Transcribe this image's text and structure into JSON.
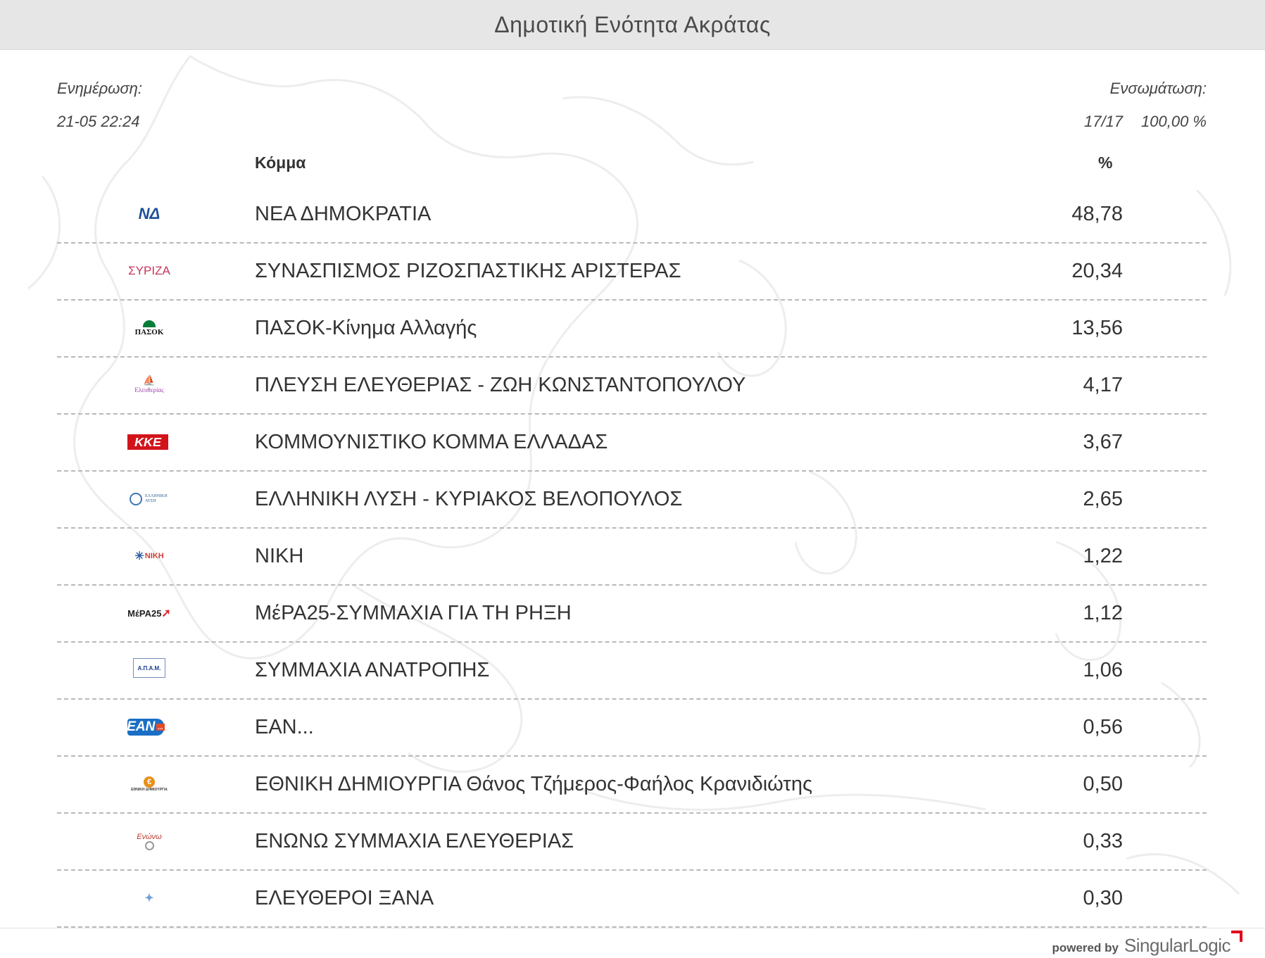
{
  "header": {
    "title": "Δημοτική Ενότητα Ακράτας"
  },
  "meta": {
    "update_label": "Ενημέρωση:",
    "update_value": "21-05 22:24",
    "incorporation_label": "Ενσωμάτωση:",
    "incorporation_count": "17/17",
    "incorporation_percent": "100,00 %"
  },
  "table": {
    "col_party": "Κόμμα",
    "col_percent": "%",
    "rows": [
      {
        "name": "ΝΕΑ ΔΗΜΟΚΡΑΤΙΑ",
        "percent": "48,78",
        "logo_icon": "nea-dimokratia-logo-icon"
      },
      {
        "name": "ΣΥΝΑΣΠΙΣΜΟΣ ΡΙΖΟΣΠΑΣΤΙΚΗΣ ΑΡΙΣΤΕΡΑΣ",
        "percent": "20,34",
        "logo_icon": "syriza-logo-icon"
      },
      {
        "name": "ΠΑΣΟΚ-Κίνημα Αλλαγής",
        "percent": "13,56",
        "logo_icon": "pasok-logo-icon"
      },
      {
        "name": "ΠΛΕΥΣΗ ΕΛΕΥΘΕΡΙΑΣ - ΖΩΗ ΚΩΝΣΤΑΝΤΟΠΟΥΛΟΥ",
        "percent": "4,17",
        "logo_icon": "plefsi-eleftherias-logo-icon"
      },
      {
        "name": "ΚΟΜΜΟΥΝΙΣΤΙΚΟ ΚΟΜΜΑ ΕΛΛΑΔΑΣ",
        "percent": "3,67",
        "logo_icon": "kke-logo-icon"
      },
      {
        "name": "ΕΛΛΗΝΙΚΗ ΛΥΣΗ - ΚΥΡΙΑΚΟΣ ΒΕΛΟΠΟΥΛΟΣ",
        "percent": "2,65",
        "logo_icon": "elliniki-lysi-logo-icon"
      },
      {
        "name": "ΝΙΚΗ",
        "percent": "1,22",
        "logo_icon": "niki-logo-icon"
      },
      {
        "name": "ΜέΡΑ25-ΣΥΜΜΑΧΙΑ ΓΙΑ ΤΗ ΡΗΞΗ",
        "percent": "1,12",
        "logo_icon": "mera25-logo-icon"
      },
      {
        "name": "ΣΥΜΜΑΧΙΑ ΑΝΑΤΡΟΠΗΣ",
        "percent": "1,06",
        "logo_icon": "symmaxia-anatropis-logo-icon"
      },
      {
        "name": "ΕΑΝ...",
        "percent": "0,56",
        "logo_icon": "ean-logo-icon"
      },
      {
        "name": "ΕΘΝΙΚΗ ΔΗΜΙΟΥΡΓΙΑ Θάνος Τζήμερος-Φαήλος Κρανιδιώτης",
        "percent": "0,50",
        "logo_icon": "ethniki-dimiourgia-logo-icon"
      },
      {
        "name": "ΕΝΩΝΩ ΣΥΜΜΑΧΙΑ ΕΛΕΥΘΕΡΙΑΣ",
        "percent": "0,33",
        "logo_icon": "enono-logo-icon"
      },
      {
        "name": "ΕΛΕΥΘΕΡΟΙ ΞΑΝΑ",
        "percent": "0,30",
        "logo_icon": "eleftheroi-xana-logo-icon"
      }
    ]
  },
  "logos": {
    "nd": "ΝΔ",
    "syriza": "ΣΥΡΙΖΑ",
    "pasok": "ΠΑΣΟΚ",
    "plefsi": "Ελευθερίας",
    "kke": "ΚΚΕ",
    "el_lysi": "ΕΛΛΗΝΙΚΗ ΛΥΣΗ",
    "niki": "ΝΙΚΗ",
    "mera": "ΜέΡΑ25",
    "anatropi": "Α.Π.Α.Μ.",
    "ean": "ΕΑΝ",
    "ean_dots": "...",
    "ed": "ΕΘΝΙΚΗ ΔΗΜΙΟΥΡΓΙΑ",
    "ed_coin": "€",
    "enono": "Ενώνω"
  },
  "footer": {
    "powered_by": "powered by",
    "brand": "SingularLogic"
  },
  "colors": {
    "header_bg": "#e6e6e6",
    "divider": "#b9b9b9",
    "brand_accent": "#e2001a"
  }
}
